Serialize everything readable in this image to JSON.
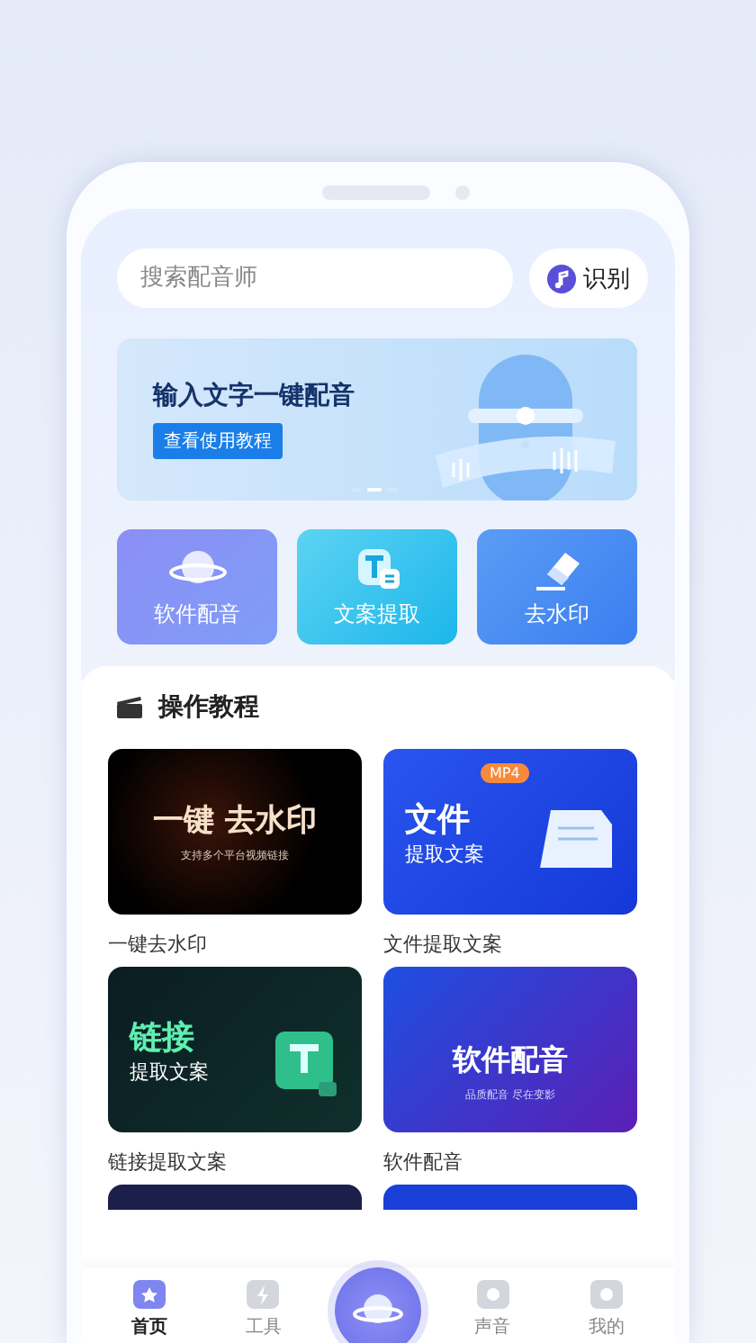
{
  "search": {
    "placeholder": "搜索配音师"
  },
  "recognize_button": {
    "label": "识别"
  },
  "banner": {
    "title": "输入文字一键配音",
    "button": "查看使用教程",
    "dots": [
      {
        "selected": false
      },
      {
        "selected": true
      },
      {
        "selected": false
      }
    ]
  },
  "tools": [
    {
      "kind": "planet",
      "label": "软件配音"
    },
    {
      "kind": "text",
      "label": "文案提取"
    },
    {
      "kind": "eraser",
      "label": "去水印"
    }
  ],
  "tutorials": {
    "title": "操作教程",
    "cards": [
      {
        "kind": "watermark",
        "lines": [
          "一键 去水印",
          "支持多个平台视频链接"
        ],
        "label": "一键去水印"
      },
      {
        "kind": "file",
        "badge": "MP4",
        "lines": [
          "文件",
          "提取文案"
        ],
        "label": "文件提取文案"
      },
      {
        "kind": "link",
        "lines": [
          "链接",
          "提取文案"
        ],
        "label": "链接提取文案"
      },
      {
        "kind": "voice",
        "lines": [
          "软件配音",
          "品质配音 尽在变影"
        ],
        "label": "软件配音"
      },
      {
        "kind": "partial-dark"
      },
      {
        "kind": "partial-blue"
      }
    ]
  },
  "tabs": [
    {
      "kind": "home",
      "label": "首页",
      "selected": true
    },
    {
      "kind": "tools",
      "label": "工具",
      "selected": false
    },
    {
      "kind": "center"
    },
    {
      "kind": "voice",
      "label": "声音",
      "selected": false
    },
    {
      "kind": "me",
      "label": "我的",
      "selected": false
    }
  ]
}
